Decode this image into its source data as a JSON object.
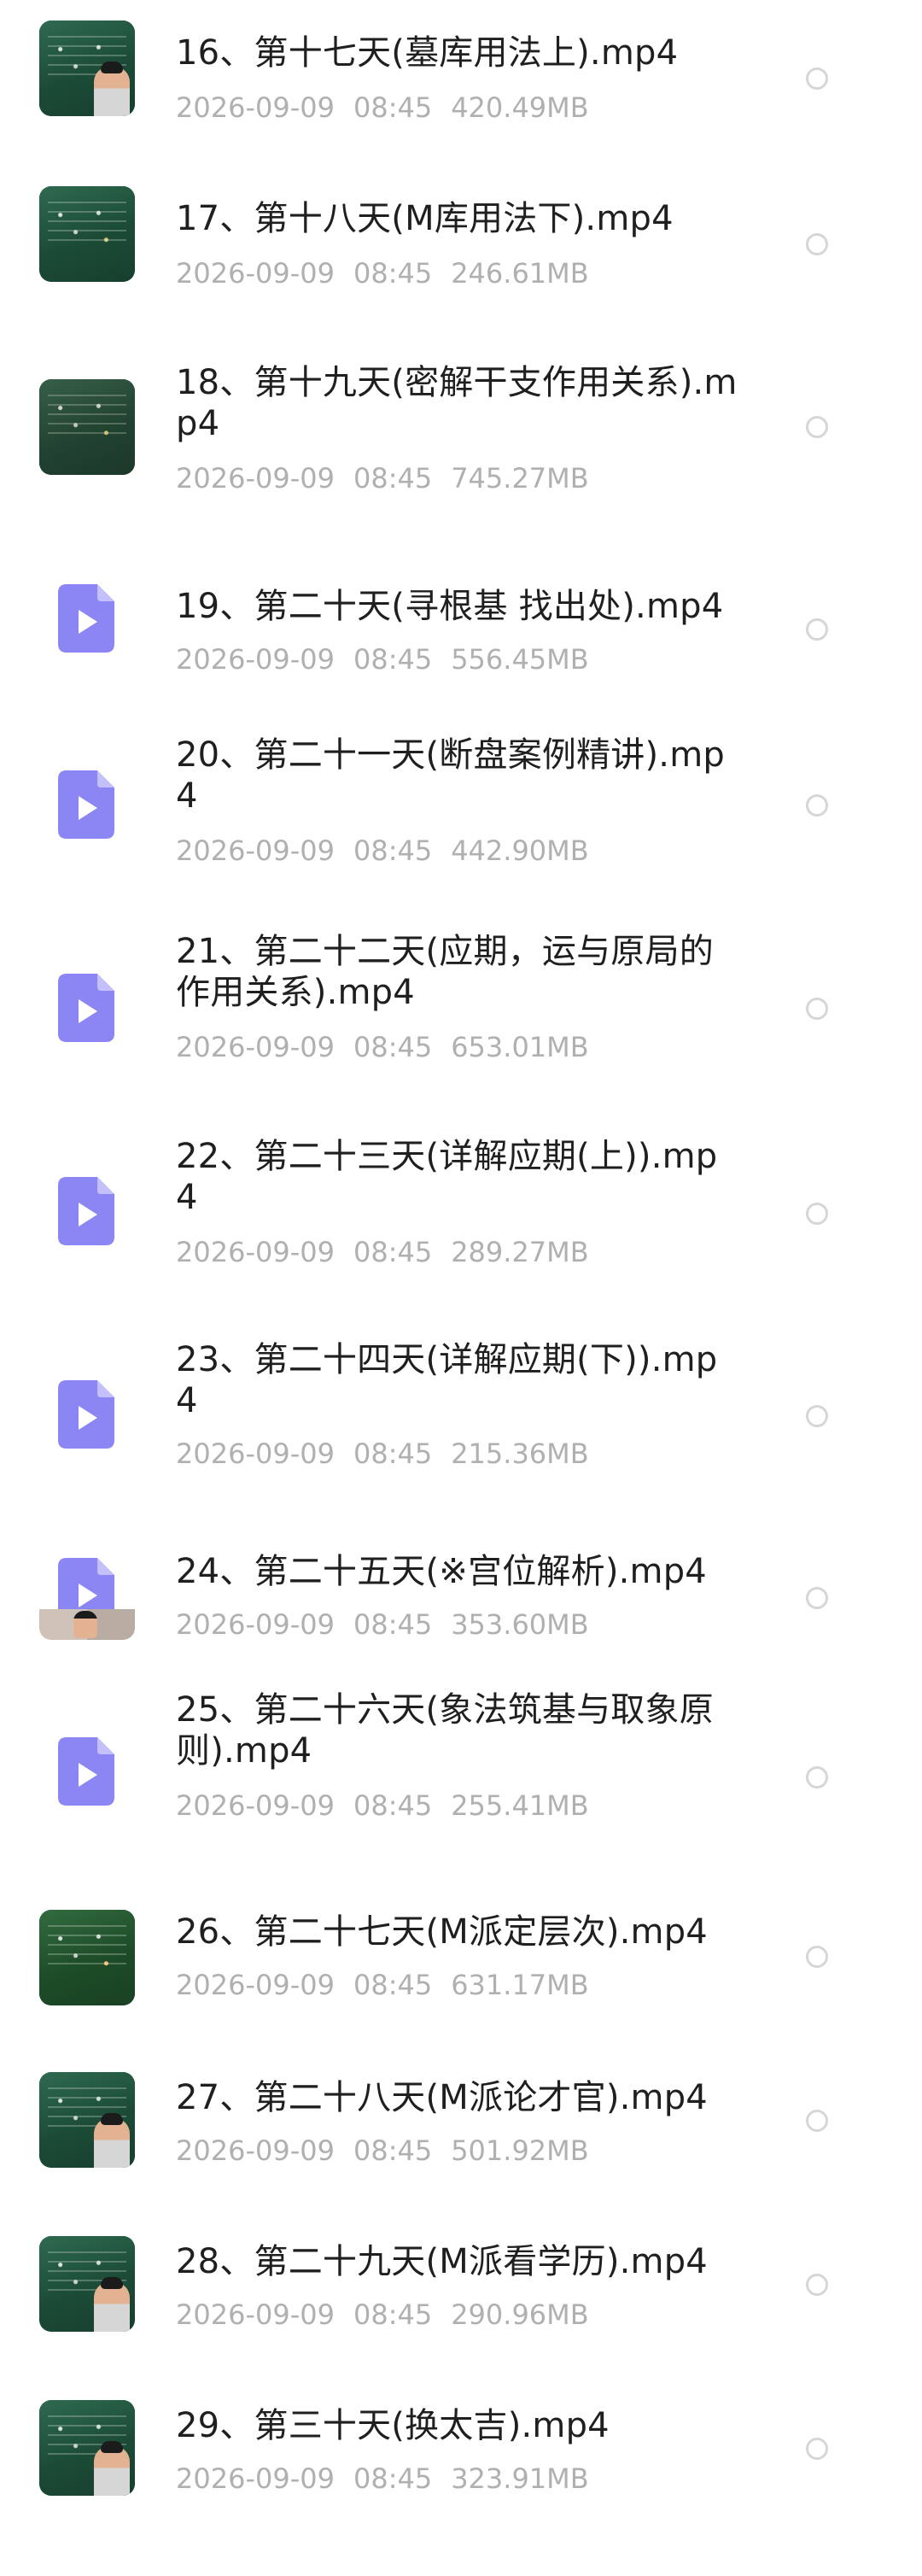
{
  "file_list": {
    "items": [
      {
        "title": "16、第十七天(墓库用法上).mp4",
        "date": "2026-09-09",
        "time": "08:45",
        "size": "420.49MB",
        "thumbnail": "video-frame"
      },
      {
        "title": "17、第十八天(M库用法下).mp4",
        "date": "2026-09-09",
        "time": "08:45",
        "size": "246.61MB",
        "thumbnail": "video-frame"
      },
      {
        "title": "18、第十九天(密解干支作用关系).mp4",
        "date": "2026-09-09",
        "time": "08:45",
        "size": "745.27MB",
        "thumbnail": "video-frame"
      },
      {
        "title": "19、第二十天(寻根基 找出处).mp4",
        "date": "2026-09-09",
        "time": "08:45",
        "size": "556.45MB",
        "thumbnail": "video-file-icon"
      },
      {
        "title": "20、第二十一天(断盘案例精讲).mp4",
        "date": "2026-09-09",
        "time": "08:45",
        "size": "442.90MB",
        "thumbnail": "video-file-icon"
      },
      {
        "title": "21、第二十二天(应期，运与原局的作用关系).mp4",
        "date": "2026-09-09",
        "time": "08:45",
        "size": "653.01MB",
        "thumbnail": "video-file-icon"
      },
      {
        "title": "22、第二十三天(详解应期(上)).mp4",
        "date": "2026-09-09",
        "time": "08:45",
        "size": "289.27MB",
        "thumbnail": "video-file-icon"
      },
      {
        "title": "23、第二十四天(详解应期(下)).mp4",
        "date": "2026-09-09",
        "time": "08:45",
        "size": "215.36MB",
        "thumbnail": "video-file-icon"
      },
      {
        "title": "24、第二十五天(※宫位解析).mp4",
        "date": "2026-09-09",
        "time": "08:45",
        "size": "353.60MB",
        "thumbnail": "video-file-icon-partial-frame"
      },
      {
        "title": "25、第二十六天(象法筑基与取象原则).mp4",
        "date": "2026-09-09",
        "time": "08:45",
        "size": "255.41MB",
        "thumbnail": "video-file-icon"
      },
      {
        "title": "26、第二十七天(M派定层次).mp4",
        "date": "2026-09-09",
        "time": "08:45",
        "size": "631.17MB",
        "thumbnail": "video-frame"
      },
      {
        "title": "27、第二十八天(M派论才官).mp4",
        "date": "2026-09-09",
        "time": "08:45",
        "size": "501.92MB",
        "thumbnail": "video-frame"
      },
      {
        "title": "28、第二十九天(M派看学历).mp4",
        "date": "2026-09-09",
        "time": "08:45",
        "size": "290.96MB",
        "thumbnail": "video-frame"
      },
      {
        "title": "29、第三十天(换太吉).mp4",
        "date": "2026-09-09",
        "time": "08:45",
        "size": "323.91MB",
        "thumbnail": "video-frame"
      }
    ]
  },
  "colors": {
    "title_text": "#1f1f1f",
    "meta_text": "#b0b0b0",
    "icon_purple": "#8b86f3",
    "radio_border": "#d6d6d6"
  }
}
